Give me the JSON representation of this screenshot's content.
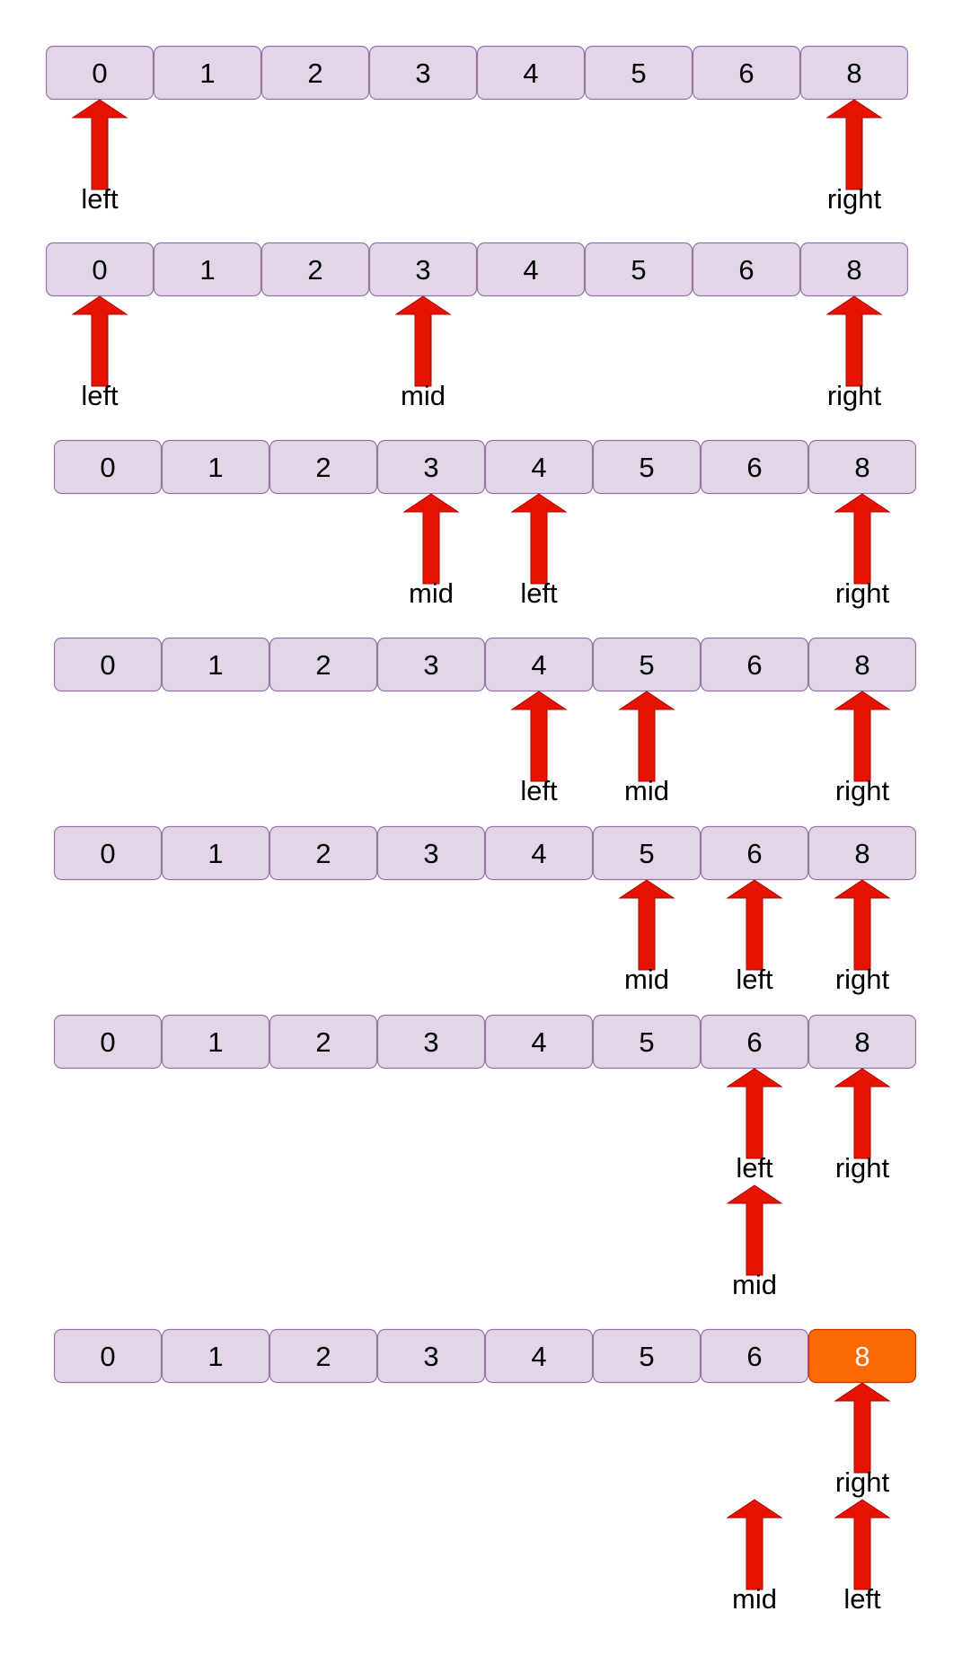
{
  "colors": {
    "cell_fill": "#e1d5e7",
    "cell_stroke": "#9673a6",
    "highlight_fill": "#fa6800",
    "highlight_stroke": "#c73500",
    "highlight_text": "#ffffff",
    "arrow_fill": "#e51400",
    "arrow_stroke": "#b20000",
    "text": "#000000"
  },
  "icons": {
    "pointer": "arrow-up-icon"
  },
  "steps": [
    {
      "values": [
        "0",
        "1",
        "2",
        "3",
        "4",
        "5",
        "6",
        "8"
      ],
      "highlight": null,
      "pointers": [
        {
          "label": "left",
          "index": 0,
          "tier": 0
        },
        {
          "label": "right",
          "index": 7,
          "tier": 0
        }
      ]
    },
    {
      "values": [
        "0",
        "1",
        "2",
        "3",
        "4",
        "5",
        "6",
        "8"
      ],
      "highlight": null,
      "pointers": [
        {
          "label": "left",
          "index": 0,
          "tier": 0
        },
        {
          "label": "mid",
          "index": 3,
          "tier": 0
        },
        {
          "label": "right",
          "index": 7,
          "tier": 0
        }
      ]
    },
    {
      "values": [
        "0",
        "1",
        "2",
        "3",
        "4",
        "5",
        "6",
        "8"
      ],
      "highlight": null,
      "pointers": [
        {
          "label": "mid",
          "index": 3,
          "tier": 0
        },
        {
          "label": "left",
          "index": 4,
          "tier": 0
        },
        {
          "label": "right",
          "index": 7,
          "tier": 0
        }
      ]
    },
    {
      "values": [
        "0",
        "1",
        "2",
        "3",
        "4",
        "5",
        "6",
        "8"
      ],
      "highlight": null,
      "pointers": [
        {
          "label": "left",
          "index": 4,
          "tier": 0
        },
        {
          "label": "mid",
          "index": 5,
          "tier": 0
        },
        {
          "label": "right",
          "index": 7,
          "tier": 0
        }
      ]
    },
    {
      "values": [
        "0",
        "1",
        "2",
        "3",
        "4",
        "5",
        "6",
        "8"
      ],
      "highlight": null,
      "pointers": [
        {
          "label": "mid",
          "index": 5,
          "tier": 0
        },
        {
          "label": "left",
          "index": 6,
          "tier": 0
        },
        {
          "label": "right",
          "index": 7,
          "tier": 0
        }
      ]
    },
    {
      "values": [
        "0",
        "1",
        "2",
        "3",
        "4",
        "5",
        "6",
        "8"
      ],
      "highlight": null,
      "pointers": [
        {
          "label": "left",
          "index": 6,
          "tier": 0
        },
        {
          "label": "right",
          "index": 7,
          "tier": 0
        },
        {
          "label": "mid",
          "index": 6,
          "tier": 1
        }
      ]
    },
    {
      "values": [
        "0",
        "1",
        "2",
        "3",
        "4",
        "5",
        "6",
        "8"
      ],
      "highlight": 7,
      "pointers": [
        {
          "label": "right",
          "index": 7,
          "tier": 0
        },
        {
          "label": "mid",
          "index": 6,
          "tier": 1
        },
        {
          "label": "left",
          "index": 7,
          "tier": 1
        }
      ]
    }
  ]
}
